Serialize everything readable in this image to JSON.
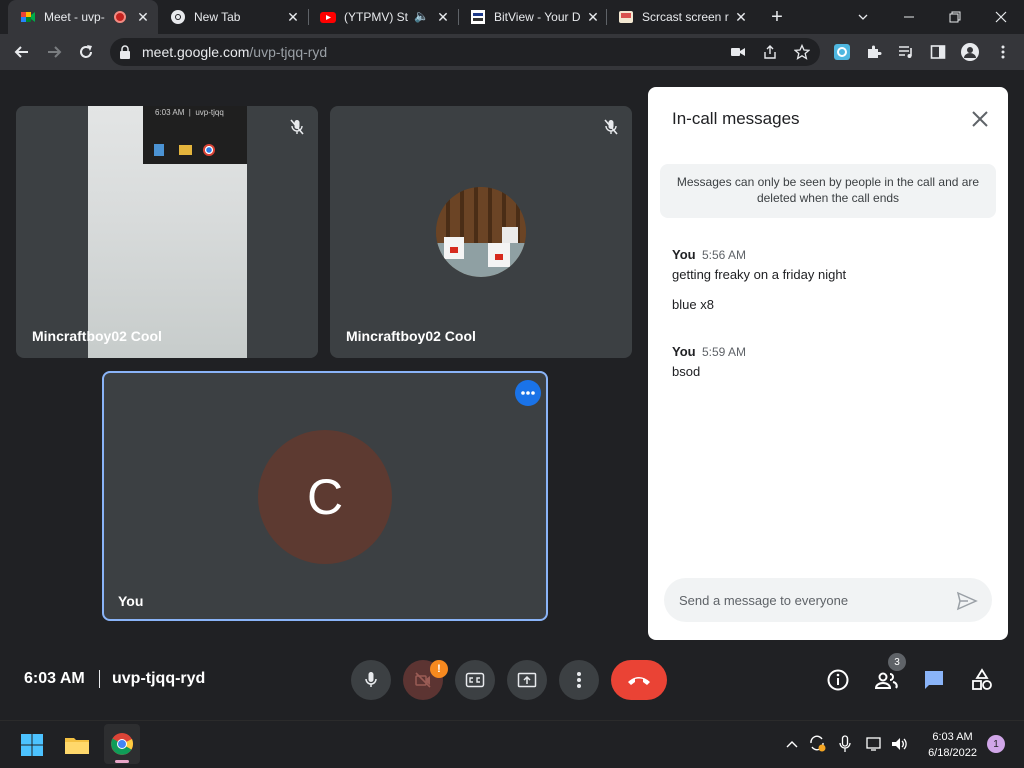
{
  "browser": {
    "tabs": [
      {
        "title": "Meet - uvp-",
        "favicon": "google-meet-icon",
        "active": true
      },
      {
        "title": "New Tab",
        "favicon": "chrome-icon"
      },
      {
        "title": "(YTPMV) St",
        "favicon": "youtube-icon"
      },
      {
        "title": "BitView - Your D",
        "favicon": "bitview-icon"
      },
      {
        "title": "Scrcast screen r",
        "favicon": "scrcast-icon"
      }
    ],
    "url_host": "meet.google.com",
    "url_path": "/uvp-tjqq-ryd"
  },
  "tiles": [
    {
      "name": "Mincraftboy02 Cool",
      "kind": "camera-feed",
      "overlay_text": "6:03 AM  |  uvp-tjqq"
    },
    {
      "name": "Mincraftboy02 Cool",
      "kind": "avatar"
    },
    {
      "name": "You",
      "kind": "initial",
      "initial": "C"
    }
  ],
  "chat": {
    "title": "In-call messages",
    "notice": "Messages can only be seen by people in the call and are deleted when the call ends",
    "messages": [
      {
        "sender": "You",
        "time": "5:56 AM",
        "texts": [
          "getting freaky on a friday night",
          "blue x8"
        ]
      },
      {
        "sender": "You",
        "time": "5:59 AM",
        "texts": [
          "bsod"
        ]
      }
    ],
    "input_placeholder": "Send a message to everyone"
  },
  "meeting": {
    "time": "6:03 AM",
    "code": "uvp-tjqq-ryd",
    "participant_count": "3",
    "camera_warning": "!"
  },
  "taskbar": {
    "time": "6:03 AM",
    "date": "6/18/2022",
    "notification_count": "1"
  },
  "colors": {
    "accent": "#8ab4f8",
    "end_call": "#ea4335",
    "avatar_you": "#5d3a31",
    "warning": "#f6891f"
  }
}
